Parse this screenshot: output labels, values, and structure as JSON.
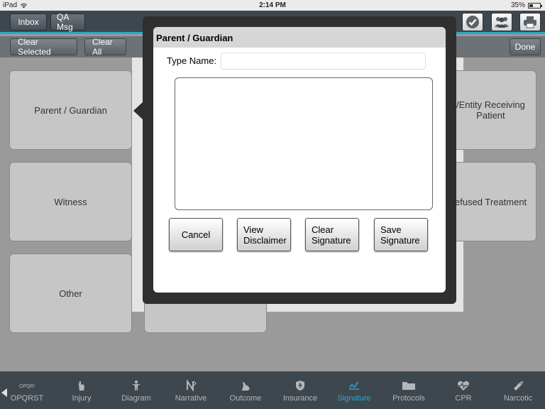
{
  "status": {
    "device": "iPad",
    "time": "2:14 PM",
    "battery": "35%"
  },
  "toolbar": {
    "inbox": "Inbox",
    "qa_msg": "QA Msg"
  },
  "subbar": {
    "clear_selected": "Clear Selected",
    "clear_all": "Clear All",
    "done": "Done"
  },
  "tiles": {
    "parent_guardian": "Parent / Guardian",
    "witness": "Witness",
    "other": "Other",
    "entity_receiving": "/Entity Receiving\nPatient",
    "refused_treatment": "efused Treatment"
  },
  "modal": {
    "title": "Parent / Guardian",
    "type_name_label": "Type Name:",
    "type_name_value": "",
    "buttons": {
      "cancel": "Cancel",
      "view_disclaimer": "View\nDisclaimer",
      "clear_signature": "Clear\nSignature",
      "save_signature": "Save\nSignature"
    }
  },
  "tabs": [
    {
      "label": "OPQRST",
      "icon": "opqrst-icon"
    },
    {
      "label": "Injury",
      "icon": "hand-icon"
    },
    {
      "label": "Diagram",
      "icon": "person-icon"
    },
    {
      "label": "Narrative",
      "icon": "narrative-icon"
    },
    {
      "label": "Outcome",
      "icon": "outcome-icon"
    },
    {
      "label": "Insurance",
      "icon": "shield-icon"
    },
    {
      "label": "Signature",
      "icon": "signature-icon"
    },
    {
      "label": "Protocols",
      "icon": "folder-icon"
    },
    {
      "label": "CPR",
      "icon": "heart-icon"
    },
    {
      "label": "Narcotic",
      "icon": "narcotic-icon"
    }
  ],
  "colors": {
    "accent": "#2aa7cf",
    "toolbar": "#3f474e",
    "tab_inactive": "#b3b7ba"
  }
}
